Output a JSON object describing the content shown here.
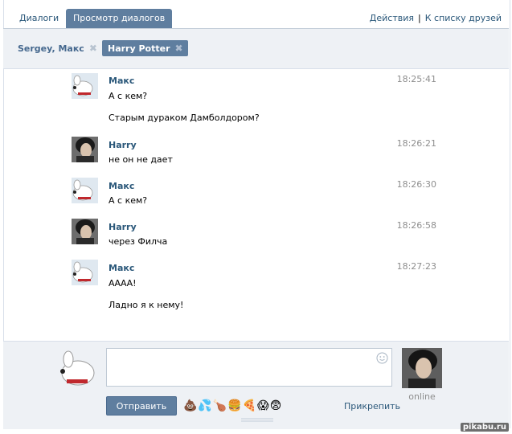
{
  "tabs": {
    "dialogs": "Диалоги",
    "view_dialogs": "Просмотр диалогов"
  },
  "top_links": {
    "actions": "Действия",
    "separator": "|",
    "to_friends": "К списку друзей"
  },
  "conversations": [
    {
      "label": "Sergey, Макс",
      "active": false
    },
    {
      "label": "Harry Potter",
      "active": true
    }
  ],
  "messages": [
    {
      "author": "Макс",
      "time": "18:25:41",
      "lines": [
        "А с кем?",
        "Старым дураком Дамболдором?"
      ],
      "avatar": "dog-avatar"
    },
    {
      "author": "Harry",
      "time": "18:26:21",
      "lines": [
        "не он не дает"
      ],
      "avatar": "harry-avatar"
    },
    {
      "author": "Макс",
      "time": "18:26:30",
      "lines": [
        "А с кем?"
      ],
      "avatar": "dog-avatar"
    },
    {
      "author": "Harry",
      "time": "18:26:58",
      "lines": [
        "через Филча"
      ],
      "avatar": "harry-avatar"
    },
    {
      "author": "Макс",
      "time": "18:27:23",
      "lines": [
        "АААА!",
        "Ладно я к нему!"
      ],
      "avatar": "dog-avatar"
    }
  ],
  "composer": {
    "input_value": "",
    "send_label": "Отправить",
    "emojis": "💩💦🍗🍔🍕😱😨",
    "attach_label": "Прикрепить",
    "partner_status": "online"
  },
  "watermark": "pikabu.ru",
  "colors": {
    "accent": "#5f7e9f",
    "link": "#2b587a",
    "panel_bg": "#eef1f5"
  }
}
